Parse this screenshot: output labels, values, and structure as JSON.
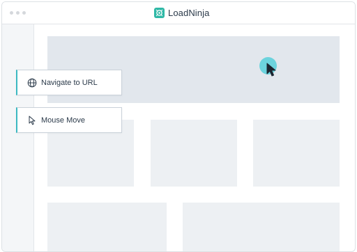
{
  "app": {
    "title": "LoadNinja",
    "logo_icon": "loadninja-logo-icon"
  },
  "colors": {
    "accent": "#3bb9c2",
    "cursor_halo": "#6cd3dd",
    "hero_block": "#e2e7ed",
    "placeholder_block": "#edf0f3",
    "text": "#2b3a4a"
  },
  "steps": [
    {
      "label": "Navigate to URL",
      "icon": "globe-icon"
    },
    {
      "label": "Mouse Move",
      "icon": "pointer-icon"
    }
  ],
  "cursor": {
    "icon": "mouse-cursor-icon"
  }
}
